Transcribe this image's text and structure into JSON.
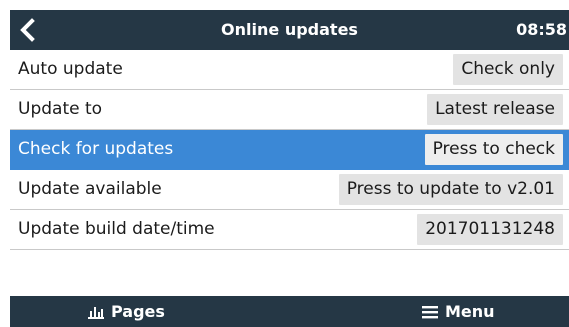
{
  "header": {
    "title": "Online updates",
    "time": "08:58",
    "back_icon": "chevron-left-icon"
  },
  "rows": [
    {
      "label": "Auto update",
      "value": "Check only",
      "selected": false
    },
    {
      "label": "Update to",
      "value": "Latest release",
      "selected": false
    },
    {
      "label": "Check for updates",
      "value": "Press to check",
      "selected": true
    },
    {
      "label": "Update available",
      "value": "Press to update to v2.01",
      "selected": false
    },
    {
      "label": "Update build date/time",
      "value": "201701131248",
      "selected": false
    }
  ],
  "footer": {
    "pages_label": "Pages",
    "pages_icon": "bar-chart-icon",
    "menu_label": "Menu",
    "menu_icon": "hamburger-icon"
  },
  "colors": {
    "header_bg": "#253745",
    "selected_bg": "#3b88d6",
    "value_bg": "#e3e3e3"
  }
}
